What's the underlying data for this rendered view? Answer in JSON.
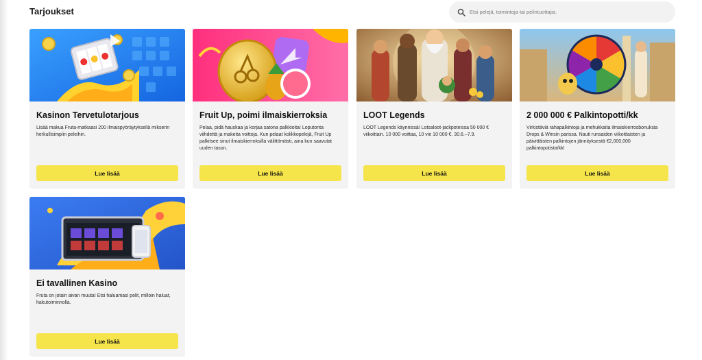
{
  "header": {
    "title": "Tarjoukset",
    "search_placeholder": "Etsi pelejä, toimintoja tai pelintuottajia."
  },
  "icons": {
    "search": "search-icon"
  },
  "colors": {
    "cta": "#f5e44a",
    "card_bg": "#f3f3f4"
  },
  "offers": [
    {
      "title": "Kasinon Tervetulotarjous",
      "description": "Lisää makua Fruta-matkaasi 200 ilmaispyöräytyksellä mikserin herkullisimpiin peleihin.",
      "button": "Lue lisää"
    },
    {
      "title": "Fruit Up, poimi ilmaiskierroksia",
      "description": "Pelaa, pidä hauskaa ja korjaa satona palkkioita! Loputonta viihdettä ja makeita voittoja. Kun pelaat kolikkopelejä, Fruit Up palkitsee sinut ilmaiskierroksilla välittömästi, aina kun saavutat uuden tason.",
      "button": "Lue lisää"
    },
    {
      "title": "LOOT Legends",
      "description": "LOOT Legends käynnissä! Lotsaloot-jackpoteissa 50 000 € viikoittain. 10 000 voittaa, 10 vie 10 000 €. 30.6.–7.9.",
      "button": "Lue lisää"
    },
    {
      "title": "2 000 000 € Palkintopotti/kk",
      "description": "Virkistäviä rahapalkintoja ja mehukkaita ilmaiskierrosbonuksia Drops & Winsin parissa. Nauti runsaiden viikoittaisten ja päivittäisten palkintojen jännityksestä €2,000,000 palkintopotista/kk!",
      "button": "Lue lisää"
    },
    {
      "title": "Ei tavallinen Kasino",
      "description": "Fruta on jotain aivan muuta! Etsi haluamasi pelit, milloin haluat, hakutoiminnolla.",
      "button": "Lue lisää"
    }
  ]
}
